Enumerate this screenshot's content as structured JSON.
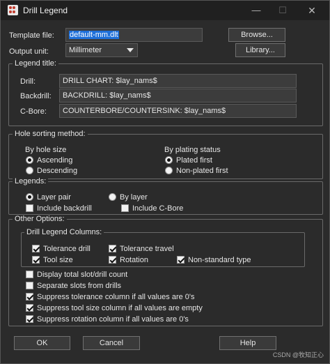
{
  "window": {
    "title": "Drill Legend"
  },
  "template": {
    "label": "Template file:",
    "value": "default-mm.dlt",
    "browse": "Browse..."
  },
  "output": {
    "label": "Output unit:",
    "value": "Millimeter",
    "library": "Library..."
  },
  "legend_title": {
    "group": "Legend title:",
    "drill_label": "Drill:",
    "drill_value": "DRILL CHART: $lay_nams$",
    "backdrill_label": "Backdrill:",
    "backdrill_value": "BACKDRILL: $lay_nams$",
    "cbore_label": "C-Bore:",
    "cbore_value": "COUNTERBORE/COUNTERSINK: $lay_nams$"
  },
  "sorting": {
    "group": "Hole sorting method:",
    "by_size": "By hole size",
    "ascending": "Ascending",
    "descending": "Descending",
    "by_plating": "By plating status",
    "plated_first": "Plated first",
    "nonplated_first": "Non-plated first"
  },
  "legends": {
    "group": "Legends:",
    "layer_pair": "Layer pair",
    "by_layer": "By layer",
    "include_backdrill": "Include backdrill",
    "include_cbore": "Include C-Bore"
  },
  "other": {
    "group": "Other Options:",
    "columns_group": "Drill Legend Columns:",
    "tolerance_drill": "Tolerance drill",
    "tolerance_travel": "Tolerance travel",
    "tool_size": "Tool size",
    "rotation": "Rotation",
    "nonstandard_type": "Non-standard type",
    "display_total": "Display total slot/drill count",
    "separate_slots": "Separate slots from drills",
    "suppress_tolerance": "Suppress tolerance column if all values are 0's",
    "suppress_toolsize": "Suppress tool size column if all values are empty",
    "suppress_rotation": "Suppress rotation column if all values are 0's"
  },
  "buttons": {
    "ok": "OK",
    "cancel": "Cancel",
    "help": "Help"
  },
  "watermark": "CSDN @牧知正心"
}
